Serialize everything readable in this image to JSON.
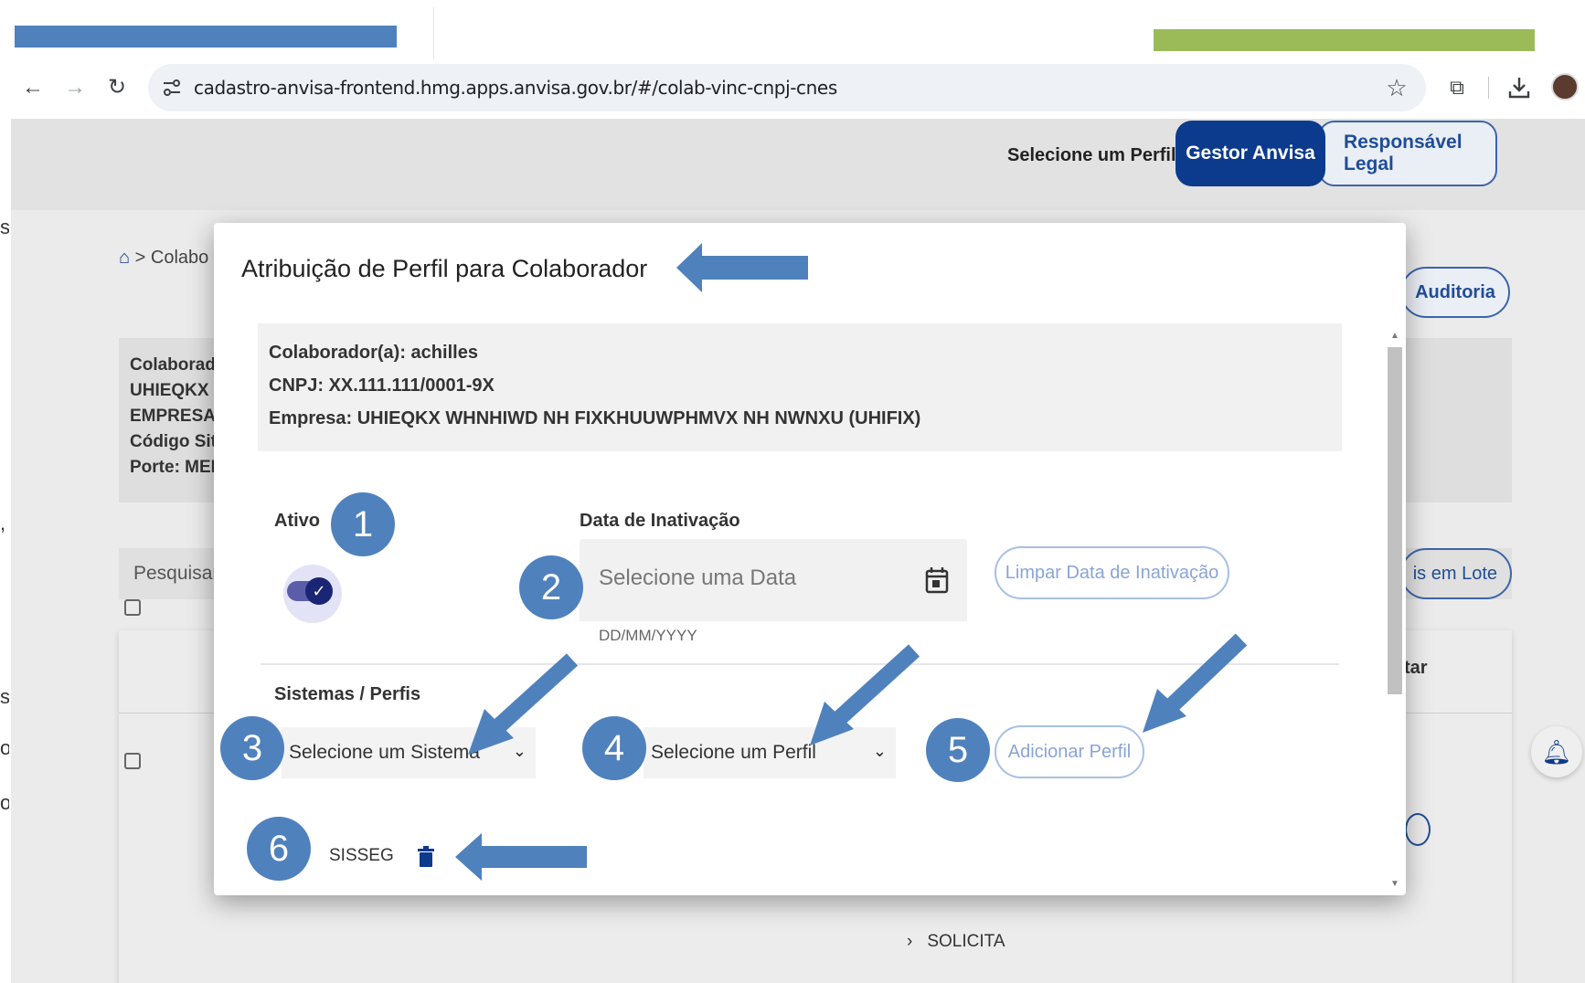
{
  "browser": {
    "url": "cadastro-anvisa-frontend.hmg.apps.anvisa.gov.br/#/colab-vinc-cnpj-cnes",
    "back_icon": "arrow-left-icon",
    "forward_icon": "arrow-right-icon",
    "reload_icon": "reload-icon"
  },
  "header": {
    "perfil_label": "Selecione um Perfil:",
    "btn_gestor": "Gestor Anvisa",
    "btn_responsavel": "Responsável Legal"
  },
  "page": {
    "breadcrumb": "> Colabo",
    "auditoria": "Auditoria",
    "info_lines": [
      "Colaborado",
      "UHIEQKX V",
      "EMPRESA I",
      "Código Situ",
      "Porte: MED"
    ],
    "search_text": "Pesquisar",
    "lote_text": "is em Lote",
    "table_col_tar": "tar",
    "solicita": "SOLICITA"
  },
  "modal": {
    "title": "Atribuição de Perfil para Colaborador",
    "colaborador": "Colaborador(a): achilles",
    "cnpj": "CNPJ: XX.111.111/0001-9X",
    "empresa": "Empresa: UHIEQKX WHNHIWD NH FIXKHUUWPHMVX NH NWNXU (UHIFIX)",
    "ativo_label": "Ativo",
    "data_label": "Data de Inativação",
    "data_placeholder": "Selecione uma Data",
    "data_hint": "DD/MM/YYYY",
    "limpar_btn": "Limpar Data de Inativação",
    "sistemas_label": "Sistemas / Perfis",
    "sistema_select": "Selecione um Sistema",
    "perfil_select": "Selecione um Perfil",
    "adicionar_btn": "Adicionar Perfil",
    "sistema_item": "SISSEG"
  },
  "markers": [
    "1",
    "2",
    "3",
    "4",
    "5",
    "6"
  ],
  "colors": {
    "annotation_blue": "#4f81bd",
    "green_bar": "#9bbb59",
    "primary_dark": "#0c3a8c"
  }
}
